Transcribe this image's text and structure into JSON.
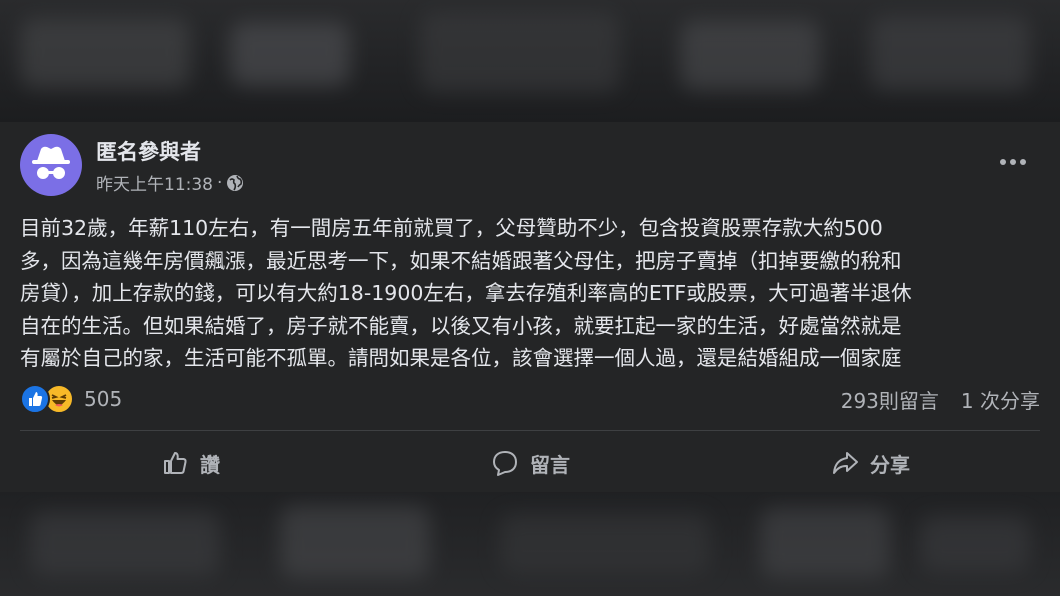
{
  "post": {
    "author": "匿名參與者",
    "timestamp": "昨天上午11:38",
    "separator": "·",
    "privacy_icon": "globe-icon",
    "more_icon": "more-options-icon",
    "body_lines": [
      "目前32歲，年薪110左右，有一間房五年前就買了，父母贊助不少，包含投資股票存款大約500",
      "多，因為這幾年房價飆漲，最近思考一下，如果不結婚跟著父母住，把房子賣掉（扣掉要繳的稅和",
      "房貸），加上存款的錢，可以有大約18-1900左右，拿去存殖利率高的ETF或股票，大可過著半退休",
      "自在的生活。但如果結婚了，房子就不能賣，以後又有小孩，就要扛起一家的生活，好處當然就是",
      "有屬於自己的家，生活可能不孤單。請問如果是各位，該會選擇一個人過，還是結婚組成一個家庭"
    ],
    "reactions": {
      "icons": [
        "like-icon",
        "haha-icon"
      ],
      "count": "505"
    },
    "comments_count": "293則留言",
    "shares_count": "1 次分享",
    "actions": {
      "like": "讚",
      "comment": "留言",
      "share": "分享"
    }
  },
  "colors": {
    "background": "#18191a",
    "card": "#242526",
    "primary_text": "#e4e6eb",
    "secondary_text": "#b0b3b8",
    "like_blue": "#1b74e4",
    "haha_yellow": "#f7b928",
    "avatar_purple": "#7b6fe6"
  }
}
